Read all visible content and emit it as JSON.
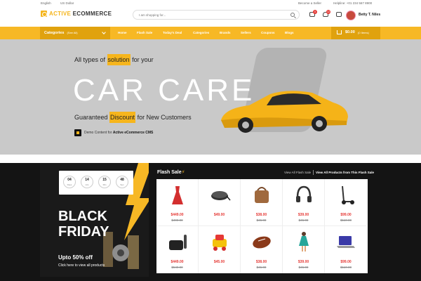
{
  "topbar": {
    "language": "English",
    "currency": "US Dollar",
    "become_seller": "Become a Seller",
    "helpline": "Helpline: +01 234 567 8900",
    "logo_part1": "ACTIVE",
    "logo_part2": "ECOMMERCE",
    "search_placeholder": "I am shopping for...",
    "compare_badge": "0",
    "wishlist_badge": "12",
    "username": "Betty T. Niles"
  },
  "nav": {
    "categories_label": "Categories",
    "categories_sub": "(See All)",
    "items": [
      "Home",
      "Flash Sale",
      "Today's Deal",
      "Categories",
      "Brands",
      "Sellers",
      "Coupons",
      "Blogs"
    ],
    "cart_total": "$0.00",
    "cart_items": "(0 Items)"
  },
  "hero": {
    "line1_pre": "All types of ",
    "line1_hl": "solution",
    "line1_post": " for your",
    "big": "CAR CARE",
    "line2_pre": "Guaranteed ",
    "line2_hl": "Discount",
    "line2_post": " for New Customers",
    "demo_pre": "Demo Content for ",
    "demo_bold": "Active eCommerce CMS"
  },
  "promo": {
    "countdown": [
      {
        "num": "04",
        "label": "Days"
      },
      {
        "num": "14",
        "label": "Hrs"
      },
      {
        "num": "15",
        "label": "Min"
      },
      {
        "num": "48",
        "label": "Sec"
      }
    ],
    "black": "BLACK",
    "friday": "FRIDAY",
    "upto": "Upto 50% off",
    "click": "Click here to view all products"
  },
  "flash": {
    "title": "Flash Sale",
    "view_all": "View All Flash Sale",
    "view_products": "View All Products from This Flash Sale",
    "products": [
      {
        "name": "dress",
        "price": "$449.00",
        "old": "$499.00"
      },
      {
        "name": "wireless-charger",
        "price": "$49.00",
        "old": ""
      },
      {
        "name": "leather-bag",
        "price": "$38.00",
        "old": "$45.00"
      },
      {
        "name": "headphones",
        "price": "$39.00",
        "old": "$45.00"
      },
      {
        "name": "scooter",
        "price": "$99.00",
        "old": "$110.00"
      },
      {
        "name": "apple-tv",
        "price": "$449.00",
        "old": "$549.00"
      },
      {
        "name": "toy-car",
        "price": "$45.00",
        "old": ""
      },
      {
        "name": "football",
        "price": "$38.00",
        "old": "$45.00"
      },
      {
        "name": "doll",
        "price": "$39.00",
        "old": "$45.00"
      },
      {
        "name": "laptop",
        "price": "$99.00",
        "old": "$110.00"
      }
    ]
  },
  "colors": {
    "accent": "#f7b825",
    "sale": "#e53935"
  }
}
